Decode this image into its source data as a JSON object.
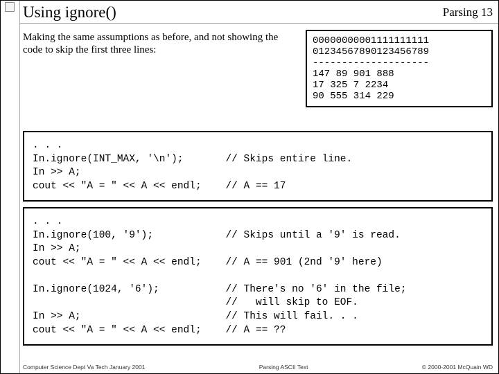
{
  "header": {
    "title": "Using ignore()",
    "topic": "Parsing  13"
  },
  "intro": "Making the same assumptions as before, and not showing the code to skip the first three lines:",
  "databox": "00000000001111111111\n01234567890123456789\n--------------------\n147 89 901 888\n17 325 7 2234\n90 555 314 229",
  "code1": ". . .\nIn.ignore(INT_MAX, '\\n');       // Skips entire line.\nIn >> A;\ncout << \"A = \" << A << endl;    // A == 17",
  "code2": ". . .\nIn.ignore(100, '9');            // Skips until a '9' is read.\nIn >> A;\ncout << \"A = \" << A << endl;    // A == 901 (2nd '9' here)\n\nIn.ignore(1024, '6');           // There's no '6' in the file;\n                                //   will skip to EOF.\nIn >> A;                        // This will fail. . .\ncout << \"A = \" << A << endl;    // A == ??",
  "footer": {
    "left": "Computer Science Dept Va Tech January 2001",
    "center": "Parsing ASCII Text",
    "right": "© 2000-2001  McQuain WD"
  }
}
